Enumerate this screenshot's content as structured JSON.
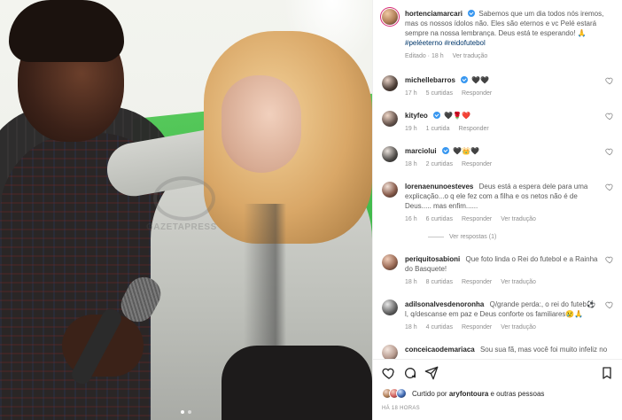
{
  "photo": {
    "watermark": "GAZETAPRESS",
    "carousel": {
      "count": 2,
      "active": 1
    }
  },
  "caption": {
    "username": "hortenciamarcari",
    "text": "Sabemos que um dia todos nós iremos, mas os nossos ídolos não. Eles são eternos e vc Pelé estará sempre na nossa lembrança. Deus está te esperando! 🙏",
    "tags": "#peléeterno #reidofutebol",
    "meta": {
      "edited": "Editado · 18 h",
      "translate": "Ver tradução"
    }
  },
  "comments": [
    {
      "username": "michellebarros",
      "verified": true,
      "text": "🖤🖤",
      "time": "17 h",
      "likes": "5 curtidas",
      "reply": "Responder",
      "translate": ""
    },
    {
      "username": "kityfeo",
      "verified": true,
      "text": "🖤🌹❤️",
      "time": "19 h",
      "likes": "1 curtida",
      "reply": "Responder",
      "translate": ""
    },
    {
      "username": "marciolui",
      "verified": true,
      "text": "🖤👑🖤",
      "time": "18 h",
      "likes": "2 curtidas",
      "reply": "Responder",
      "translate": ""
    },
    {
      "username": "lorenaenunoesteves",
      "verified": false,
      "text": "Deus está a espera dele para uma explicação...o q ele fez com a filha e os netos não é de Deus..... mas enfim......",
      "time": "16 h",
      "likes": "6 curtidas",
      "reply": "Responder",
      "translate": "Ver tradução",
      "replies": "Ver respostas (1)"
    },
    {
      "username": "periquitosabioni",
      "verified": false,
      "text": "Que foto linda o Rei do futebol e a Rainha do Basquete!",
      "time": "18 h",
      "likes": "8 curtidas",
      "reply": "Responder",
      "translate": "Ver tradução"
    },
    {
      "username": "adilsonalvesdenoronha",
      "verified": false,
      "text": "Q/grande perda:, o rei do futeb⚽l, q/descanse em paz e Deus conforte os familiares😢🙏",
      "time": "18 h",
      "likes": "4 curtidas",
      "reply": "Responder",
      "translate": "Ver tradução"
    },
    {
      "username": "conceicaodemariaca",
      "verified": false,
      "text": "Sou sua fã, mas você foi muito infeliz no",
      "time": "",
      "likes": "",
      "reply": "",
      "translate": ""
    }
  ],
  "liked_by": {
    "prefix": "Curtido por",
    "user": "aryfontoura",
    "suffix": "e outras pessoas"
  },
  "post_time": "HÁ 18 HORAS",
  "colors": {
    "verified": "#3897f0",
    "link": "#00376b",
    "muted": "#8e8e8e"
  }
}
